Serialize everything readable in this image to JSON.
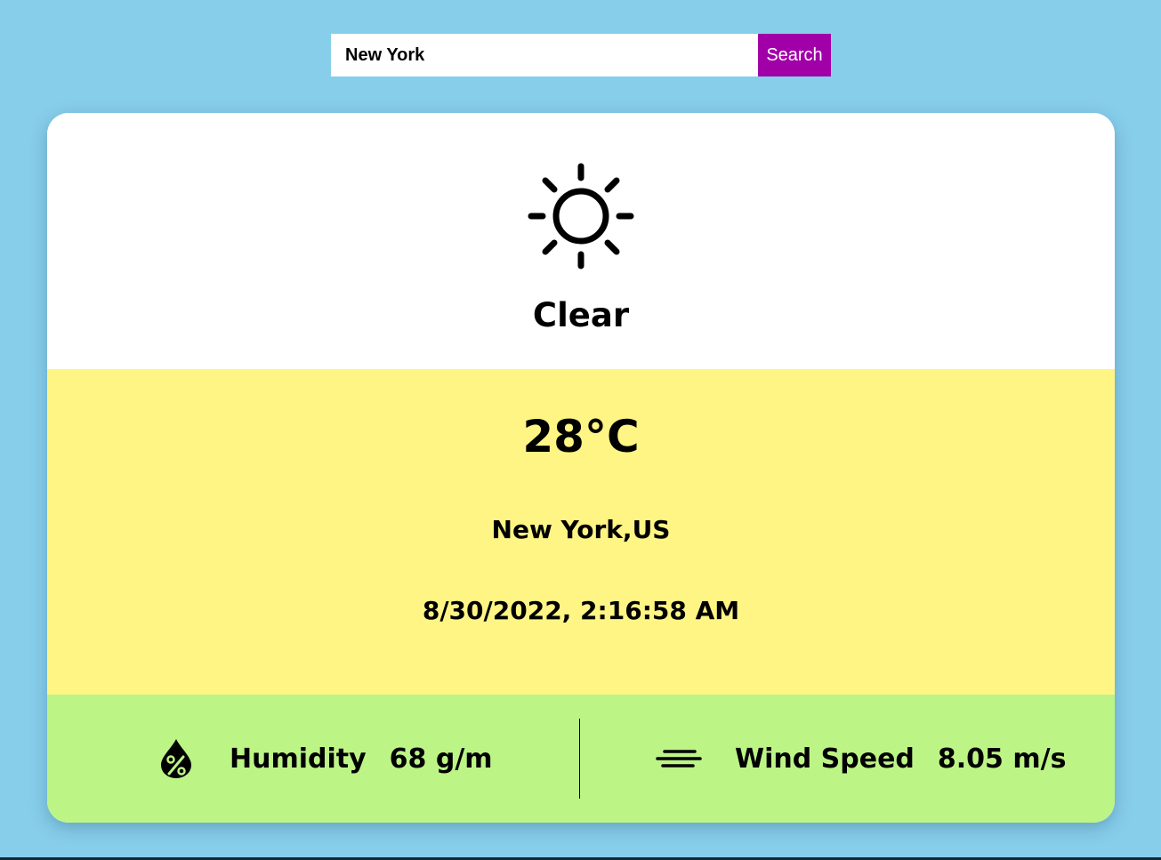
{
  "search": {
    "value": "New York",
    "button_label": "Search"
  },
  "weather": {
    "condition_icon": "sun-icon",
    "condition": "Clear",
    "temperature": "28°C",
    "location": "New York,US",
    "datetime": "8/30/2022, 2:16:58 AM"
  },
  "stats": {
    "humidity": {
      "icon": "humidity-drop-icon",
      "label": "Humidity",
      "value": "68 g/m"
    },
    "wind": {
      "icon": "wind-icon",
      "label": "Wind Speed",
      "value": "8.05 m/s"
    }
  },
  "colors": {
    "page_background": "#87ceeb",
    "search_button": "#a100a8",
    "condition_panel": "#ffffff",
    "info_panel": "#fef584",
    "stats_panel": "#bdf486"
  }
}
